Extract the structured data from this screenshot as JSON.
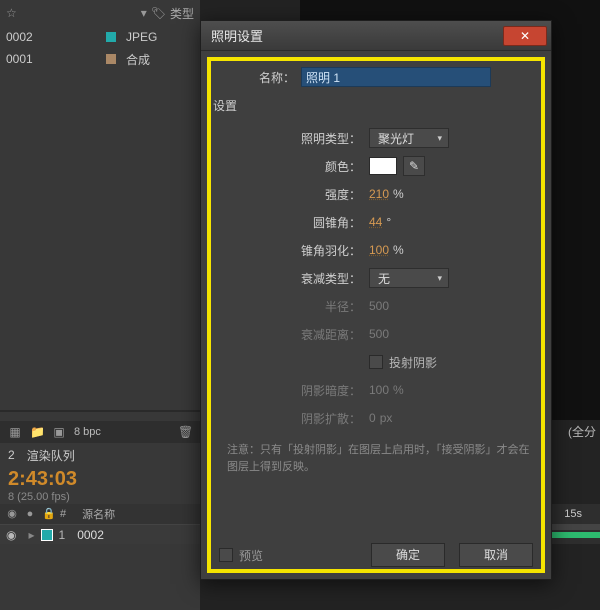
{
  "project_panel": {
    "star_icon": "☆",
    "chevron_icon": "▾",
    "tag_icon": "🏷",
    "type_header": "类型",
    "rows": [
      {
        "name": "0002",
        "type": "JPEG"
      },
      {
        "name": "0001",
        "type": "合成"
      }
    ]
  },
  "toolbar": {
    "bpc": "8 bpc",
    "bin_icon": "▦",
    "folder_icon": "📁",
    "new_comp_icon": "▣",
    "trash_icon": "🗑"
  },
  "tabs": {
    "timeline": "2",
    "render_queue": "渲染队列"
  },
  "timecode": {
    "value": "2:43:03",
    "sub": "8 (25.00 fps)"
  },
  "layer_panel": {
    "col_eye": "◉",
    "col_lock": "🔒",
    "col_solo": "●",
    "col_index": "#",
    "col_source": "源名称",
    "row": {
      "index": "1",
      "name": "0002",
      "tw": "▸"
    }
  },
  "timeline_right": {
    "time_label": "15s",
    "gfen": "(全分"
  },
  "dialog": {
    "title": "照明设置",
    "close_glyph": "✕",
    "name_label": "名称：",
    "name_value": "照明 1",
    "section": "设置",
    "labels": {
      "light_type": "照明类型：",
      "color": "颜色：",
      "intensity": "强度：",
      "cone_angle": "圆锥角：",
      "cone_feather": "锥角羽化：",
      "falloff_type": "衰减类型：",
      "radius": "半径：",
      "falloff_distance": "衰减距离：",
      "cast_shadows": "投射阴影",
      "shadow_darkness": "阴影暗度：",
      "shadow_diffusion": "阴影扩散："
    },
    "values": {
      "light_type": "聚光灯",
      "intensity": "210",
      "cone_angle": "44",
      "cone_feather": "100",
      "falloff_type": "无",
      "radius": "500",
      "falloff_distance": "500",
      "shadow_darkness": "100",
      "shadow_diffusion": "0"
    },
    "units": {
      "percent": "%",
      "deg": "°",
      "px": "px"
    },
    "note": "注意：只有「投射阴影」在图层上启用时，「接受阴影」才会在图层上得到反映。",
    "buttons": {
      "preview": "预览",
      "ok": "确定",
      "cancel": "取消"
    },
    "dd_arrow": "▾",
    "eyedrop_icon": "✎"
  }
}
